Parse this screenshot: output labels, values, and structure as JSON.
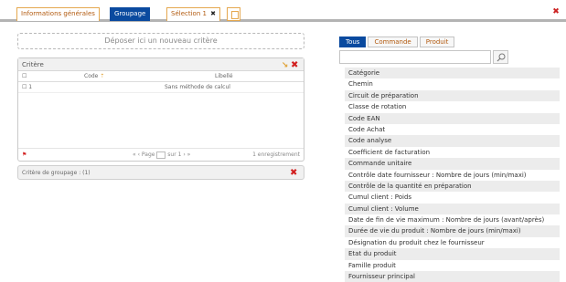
{
  "tabs": [
    {
      "label": "Informations générales",
      "active": false
    },
    {
      "label": "Groupage",
      "active": true
    },
    {
      "label": "Sélection 1",
      "active": false,
      "close": "✖"
    }
  ],
  "dropzone": {
    "text": "Déposer ici un nouveau critère"
  },
  "criterion": {
    "title": "Critère",
    "columns": {
      "check": "☐",
      "code": "Code",
      "libelle": "Libellé"
    },
    "rows": [
      {
        "check": "☐ 1",
        "code": "",
        "libelle": "Sans méthode de calcul"
      }
    ],
    "pager": {
      "page_label": "Page",
      "of_label": "sur 1",
      "count": "1 enregistrement"
    }
  },
  "accordion": {
    "label": "Critère de groupage : (1)"
  },
  "right": {
    "tabs": [
      {
        "label": "Tous",
        "active": true
      },
      {
        "label": "Commande",
        "active": false
      },
      {
        "label": "Produit",
        "active": false
      }
    ],
    "search": {
      "value": "",
      "placeholder": ""
    },
    "items": [
      "Catégorie",
      "Chemin",
      "Circuit de préparation",
      "Classe de rotation",
      "Code EAN",
      "Code Achat",
      "Code analyse",
      "Coefficient de facturation",
      "Commande unitaire",
      "Contrôle date fournisseur : Nombre de jours (min/maxi)",
      "Contrôle de la quantité en préparation",
      "Cumul client : Poids",
      "Cumul client : Volume",
      "Date de fin de vie maximum : Nombre de jours (avant/après)",
      "Durée de vie du produit : Nombre de jours (min/maxi)",
      "Désignation du produit chez le fournisseur",
      "Etat du produit",
      "Famille produit",
      "Fournisseur principal"
    ]
  }
}
